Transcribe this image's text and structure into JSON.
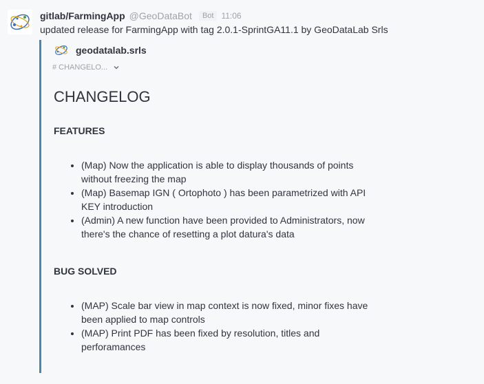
{
  "message": {
    "room": "gitlab/FarmingApp",
    "username": "@GeoDataBot",
    "badge": "Bot",
    "time": "11:06",
    "text": "updated release for FarmingApp with tag 2.0.1-SprintGA11.1 by GeoDataLab Srls"
  },
  "attachment": {
    "author": "geodatalab.srls",
    "collapse_label": "# CHANGELO...",
    "accent_color": "#4b88a8",
    "title": "CHANGELOG",
    "features_heading": "FEATURES",
    "features": [
      "(Map) Now the application is able to display thousands of points without freezing the map",
      "(Map) Basemap IGN ( Ortophoto ) has been parametrized with API KEY introduction",
      "(Admin) A new function have been provided to Administrators, now there's the chance of resetting a plot datura's data"
    ],
    "bugs_heading": "BUG SOLVED",
    "bugs": [
      "(MAP) Scale bar view in map context is now fixed, minor fixes have been applied to map controls",
      "(MAP) Print PDF has been fixed by resolution, titles and perforamances"
    ]
  },
  "icons": {
    "avatar": "geodata-logo-icon",
    "collapse": "chevron-down-icon"
  }
}
